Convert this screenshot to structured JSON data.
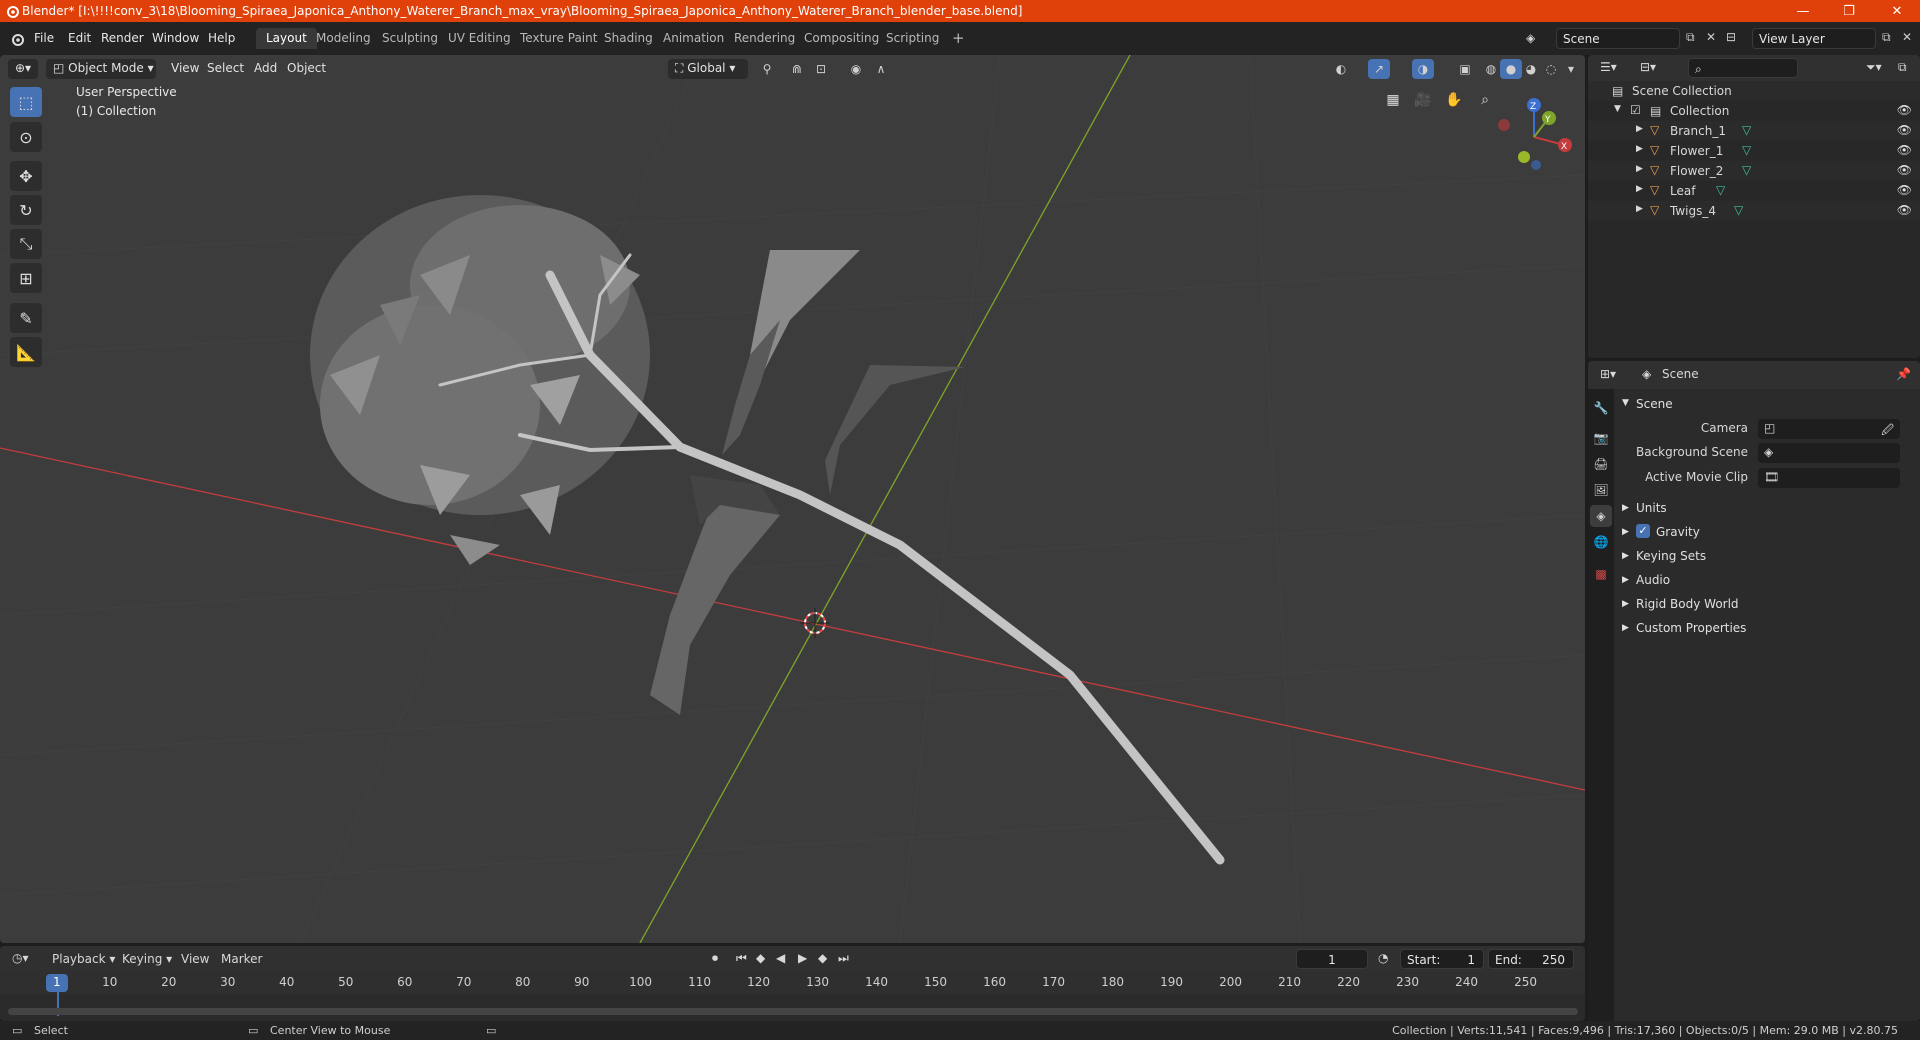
{
  "window": {
    "title": "Blender* [I:\\!!!!conv_3\\18\\Blooming_Spiraea_Japonica_Anthony_Waterer_Branch_max_vray\\Blooming_Spiraea_Japonica_Anthony_Waterer_Branch_blender_base.blend]",
    "minimize": "—",
    "maximize": "❐",
    "close": "✕"
  },
  "menu": {
    "file": "File",
    "edit": "Edit",
    "render": "Render",
    "window": "Window",
    "help": "Help"
  },
  "workspaces": [
    "Layout",
    "Modeling",
    "Sculpting",
    "UV Editing",
    "Texture Paint",
    "Shading",
    "Animation",
    "Rendering",
    "Compositing",
    "Scripting"
  ],
  "workspace_add": "+",
  "scene_field": "Scene",
  "view_layer_field": "View Layer",
  "viewport": {
    "mode": "Object Mode",
    "menus": {
      "view": "View",
      "select": "Select",
      "add": "Add",
      "object": "Object"
    },
    "orientation": "Global",
    "perspective": "User Perspective",
    "collection": "(1) Collection",
    "gizmo": {
      "x": "X",
      "y": "Y",
      "z": "Z"
    }
  },
  "outliner": {
    "root": "Scene Collection",
    "collection": "Collection",
    "objects": [
      "Branch_1",
      "Flower_1",
      "Flower_2",
      "Leaf",
      "Twigs_4"
    ]
  },
  "properties": {
    "context": "Scene",
    "panel": "Scene",
    "fields": {
      "camera": "Camera",
      "background_scene": "Background Scene",
      "active_movie_clip": "Active Movie Clip"
    },
    "sections": [
      "Units",
      "Gravity",
      "Keying Sets",
      "Audio",
      "Rigid Body World",
      "Custom Properties"
    ]
  },
  "timeline": {
    "menus": {
      "playback": "Playback",
      "keying": "Keying",
      "view": "View",
      "marker": "Marker"
    },
    "current_frame": "1",
    "start_label": "Start:",
    "start_value": "1",
    "end_label": "End:",
    "end_value": "250",
    "ticks": [
      "1",
      "10",
      "20",
      "30",
      "40",
      "50",
      "60",
      "70",
      "80",
      "90",
      "100",
      "110",
      "120",
      "130",
      "140",
      "150",
      "160",
      "170",
      "180",
      "190",
      "200",
      "210",
      "220",
      "230",
      "240",
      "250"
    ]
  },
  "status": {
    "select": "Select",
    "center_view": "Center View to Mouse",
    "info": "Collection | Verts:11,541 | Faces:9,496 | Tris:17,360 | Objects:0/5 | Mem: 29.0 MB | v2.80.75"
  },
  "colors": {
    "title_bar": "#e0400a",
    "accent": "#4772b3",
    "x_axis": "#c43c3c",
    "y_axis": "#7fa42a",
    "mesh_icon": "#e8a04a",
    "data_icon": "#3fbfa0"
  }
}
